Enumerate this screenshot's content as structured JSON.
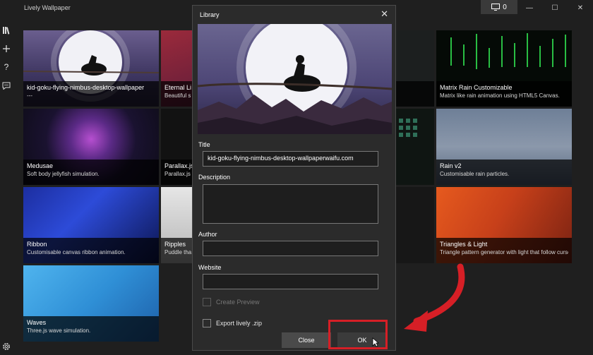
{
  "app": {
    "title": "Lively Wallpaper",
    "monitor_count": "0"
  },
  "window_controls": {
    "minimize": "—",
    "maximize": "☐",
    "close": "✕"
  },
  "sidebar": [
    "library-icon",
    "add-icon",
    "help-icon",
    "chat-icon"
  ],
  "tiles": [
    {
      "title": "kid-goku-flying-nimbus-desktop-wallpaper",
      "desc": "---"
    },
    {
      "title": "Eternal Li",
      "desc": "Beautiful s"
    },
    {
      "title": "",
      "desc": "ts with"
    },
    {
      "title": "Matrix Rain Customizable",
      "desc": "Matrix like rain animation using HTML5 Canvas."
    },
    {
      "title": "Medusae",
      "desc": "Soft body jellyfish simulation."
    },
    {
      "title": "Parallax.js",
      "desc": "Parallax.js"
    },
    {
      "title": "Rain v2",
      "desc": "Customisable rain particles."
    },
    {
      "title": "Ribbon",
      "desc": "Customisable canvas ribbon animation."
    },
    {
      "title": "Ripples",
      "desc": "Puddle tha"
    },
    {
      "title": "Triangles & Light",
      "desc": "Triangle pattern generator with light that follow cursor."
    },
    {
      "title": "Waves",
      "desc": "Three.js wave simulation."
    }
  ],
  "dialog": {
    "title": "Library",
    "close_glyph": "✕",
    "title_label": "Title",
    "title_value": "kid-goku-flying-nimbus-desktop-wallpaperwaifu.com",
    "description_label": "Description",
    "description_value": "",
    "author_label": "Author",
    "author_value": "",
    "website_label": "Website",
    "website_value": "",
    "create_preview_label": "Create Preview",
    "export_label": "Export lively .zip",
    "close_button": "Close",
    "ok_button": "OK"
  },
  "colors": {
    "annotation_red": "#d61f26"
  }
}
